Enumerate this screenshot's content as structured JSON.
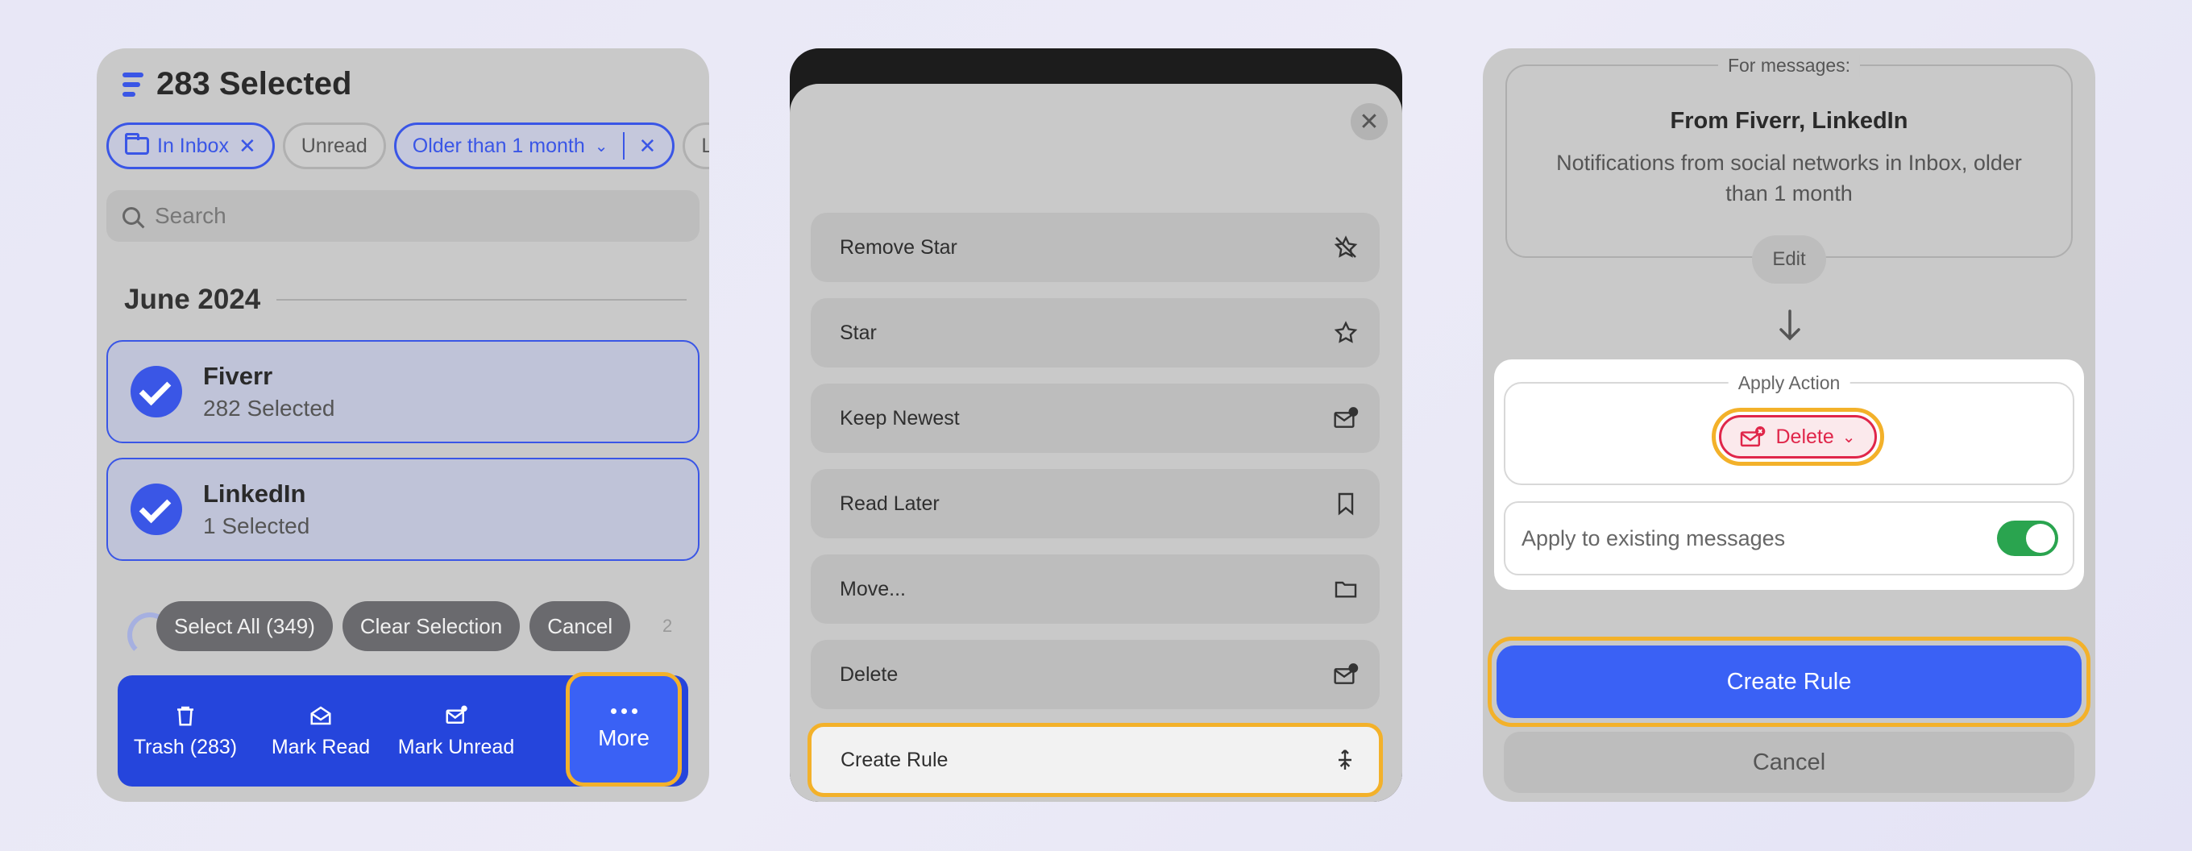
{
  "panel1": {
    "title": "283 Selected",
    "chips": {
      "in_inbox": "In Inbox",
      "unread": "Unread",
      "older": "Older than 1 month",
      "partial": "L"
    },
    "search_placeholder": "Search",
    "section": "June 2024",
    "groups": [
      {
        "name": "Fiverr",
        "sub": "282 Selected"
      },
      {
        "name": "LinkedIn",
        "sub": "1 Selected"
      }
    ],
    "pills": [
      "Select All (349)",
      "Clear Selection",
      "Cancel"
    ],
    "pill_count": "2",
    "toolbar": {
      "trash": "Trash (283)",
      "mark_read": "Mark Read",
      "mark_unread": "Mark Unread",
      "more": "More"
    }
  },
  "panel2": {
    "menu": [
      "Remove Star",
      "Star",
      "Keep Newest",
      "Read Later",
      "Move...",
      "Delete",
      "Create Rule"
    ],
    "icons": [
      "star-slash-icon",
      "star-icon",
      "mail-clock-icon",
      "bookmark-icon",
      "folder-icon",
      "mail-x-icon",
      "rule-icon"
    ]
  },
  "panel3": {
    "legend": "For messages:",
    "from": "From Fiverr, LinkedIn",
    "description": "Notifications from social networks in Inbox, older than 1 month",
    "edit": "Edit",
    "apply_action": "Apply Action",
    "delete": "Delete",
    "apply_existing": "Apply to existing messages",
    "apply_existing_on": true,
    "create_rule": "Create Rule",
    "cancel": "Cancel"
  },
  "colors": {
    "accent": "#3a56e6",
    "highlight": "#f3b12a",
    "danger": "#e0264a",
    "toggle_on": "#2aa44f"
  }
}
